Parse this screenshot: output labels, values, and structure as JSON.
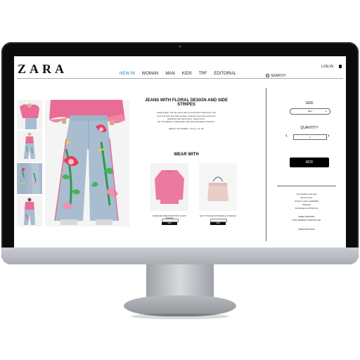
{
  "brand": {
    "logo": "ZARA"
  },
  "header": {
    "login": "LOG IN",
    "nav": [
      "NEW IN",
      "WOMAN",
      "MAN",
      "KIDS",
      "TRF",
      "EDITORIAL"
    ],
    "active_nav": "NEW IN",
    "search": "SEARCH"
  },
  "product": {
    "title": "JEANS WITH FLORAL DESIGN AND SIDE STRIPES",
    "description": "Ankle-length, mid-rise jeans with zip and button fastening in the front and front and back pockets. Features belt loops along the waistband and asymmetric, frayed hems.",
    "collab": "OIL ON DENIM. Collaboration with artist RICARDO CAVOLO.",
    "model_height": "HEIGHT OF MODEL: 176 cm. | 5' 10″"
  },
  "wear_with": {
    "heading": "WEAR WITH",
    "items": [
      {
        "label": "OVERSIZED SWEATSHIRT WITH FLUFFY SLEEVES",
        "add": "ADD"
      },
      {
        "label": "SOFT TOTE BAG WITH METALLIC HANDLES",
        "add": "ADD"
      }
    ]
  },
  "purchase": {
    "size_label": "SIZE",
    "size_value": "38-2",
    "quantity_label": "QUANTITY",
    "quantity_value": "1",
    "add_label": "ADD"
  },
  "info": {
    "links": [
      "Composition and care",
      "Find my size",
      "Check in-store availability",
      "Shipping",
      "Exchanges and Returns"
    ],
    "shipping": [
      "FREE SHIPPING",
      "FOR ORDERS OVER 50 USD"
    ],
    "returns": "FREE RETURNS"
  },
  "colors": {
    "accent": "#2d7fb8",
    "pink": "#e8759a",
    "denim": "#a9bdd0"
  }
}
